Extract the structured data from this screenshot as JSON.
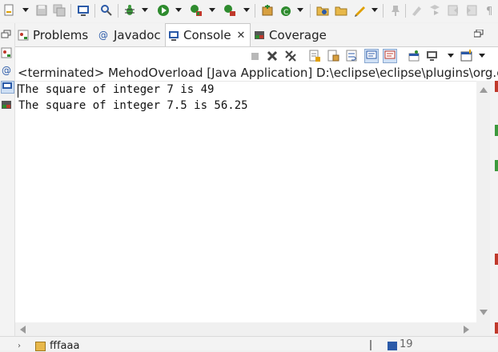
{
  "tabs": [
    {
      "label": "Problems",
      "icon": "problems-icon"
    },
    {
      "label": "Javadoc",
      "icon": "at-sign-icon"
    },
    {
      "label": "Console",
      "icon": "console-icon",
      "active": true
    },
    {
      "label": "Coverage",
      "icon": "coverage-icon"
    }
  ],
  "close_glyph": "✕",
  "javadoc_glyph": "@",
  "status_line": "<terminated> MehodOverload [Java Application] D:\\eclipse\\eclipse\\plugins\\org.e",
  "console_lines": [
    "The square of integer 7 is 49",
    "The square of integer 7.5 is 56.25"
  ],
  "bottom_partial": {
    "left": "fffaaa",
    "right": "19"
  },
  "colors": {
    "background": "#f0f0f0",
    "editor": "#ffffff",
    "console_text": "#111111",
    "accent_blue": "#2b5aa8",
    "run_green": "#2e8b2e",
    "debug_green": "#3d9a3d",
    "stop_red": "#c0392b"
  }
}
